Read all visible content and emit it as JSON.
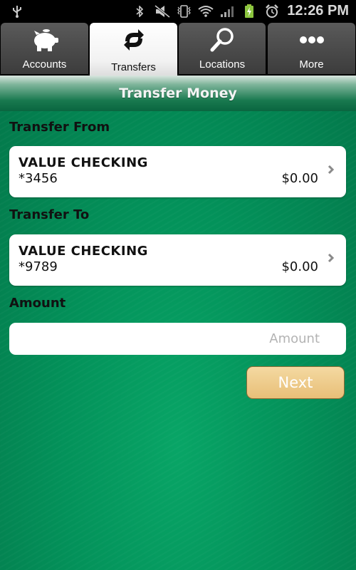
{
  "status_bar": {
    "time": "12:26 PM",
    "icons": [
      "usb-icon",
      "bluetooth-icon",
      "mute-icon",
      "vibrate-icon",
      "wifi-icon",
      "signal-icon",
      "battery-charging-icon",
      "alarm-icon"
    ]
  },
  "tabs": [
    {
      "label": "Accounts",
      "icon": "piggy-bank-icon",
      "active": false
    },
    {
      "label": "Transfers",
      "icon": "transfer-arrows-icon",
      "active": true
    },
    {
      "label": "Locations",
      "icon": "search-icon",
      "active": false
    },
    {
      "label": "More",
      "icon": "more-dots-icon",
      "active": false
    }
  ],
  "page": {
    "title": "Transfer Money",
    "colors": {
      "background": "#03925a",
      "button": "#e8bf78"
    }
  },
  "transfer_from": {
    "label": "Transfer From",
    "account_name": "VALUE CHECKING",
    "account_number": "*3456",
    "balance": "$0.00"
  },
  "transfer_to": {
    "label": "Transfer To",
    "account_name": "VALUE CHECKING",
    "account_number": "*9789",
    "balance": "$0.00"
  },
  "amount": {
    "label": "Amount",
    "value": "",
    "placeholder": "Amount"
  },
  "next_button": {
    "label": "Next"
  }
}
